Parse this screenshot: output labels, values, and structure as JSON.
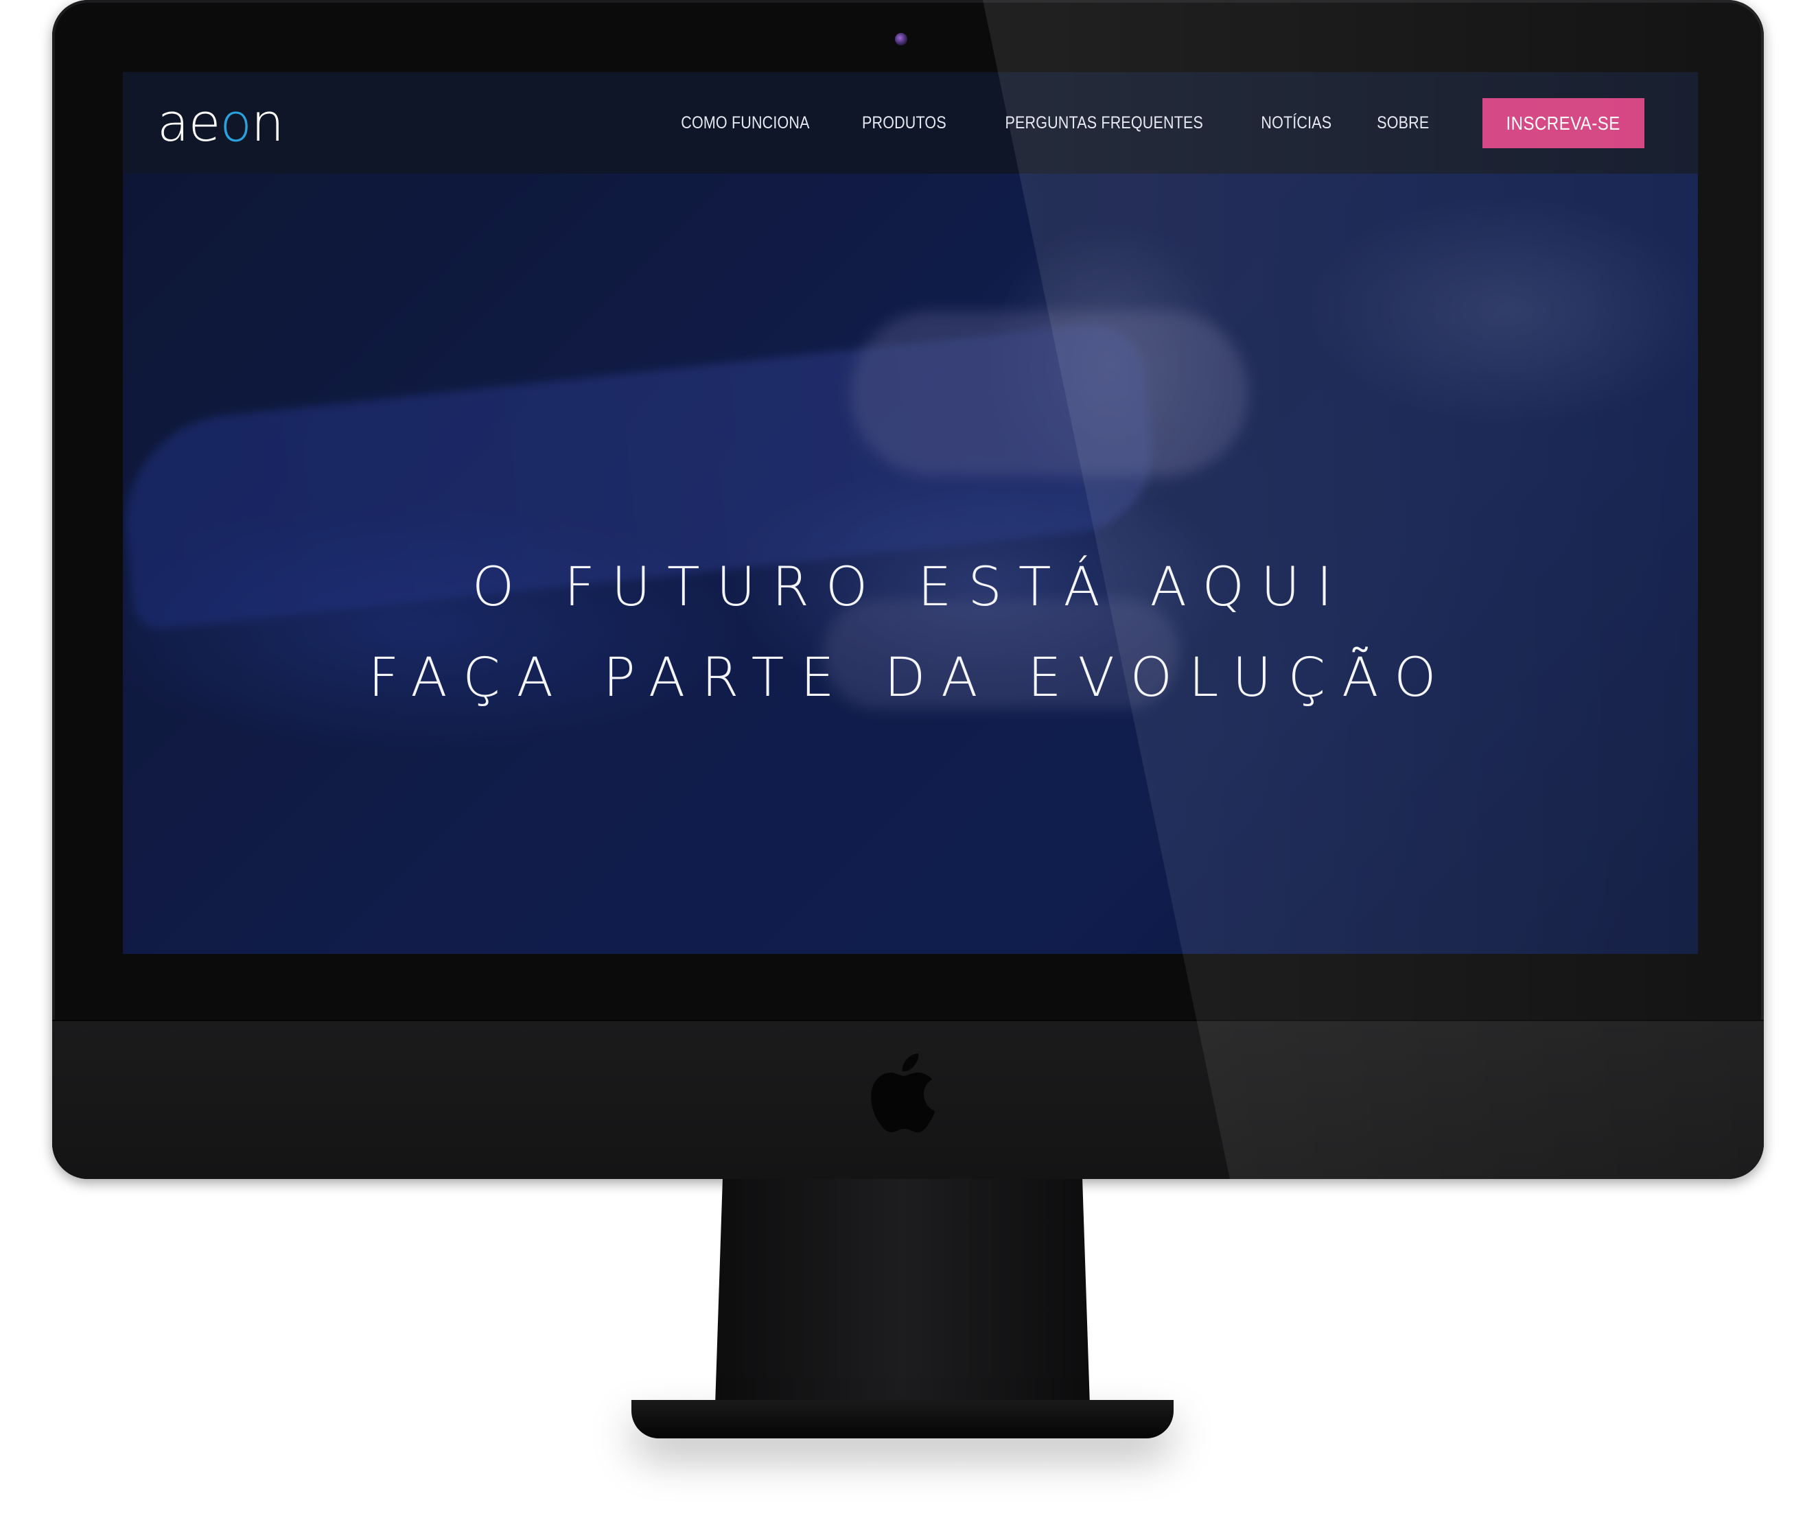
{
  "brand": {
    "logo_prefix": "ae",
    "logo_o": "o",
    "logo_suffix": "n",
    "accent_color": "#28a3e0"
  },
  "nav": {
    "items": [
      {
        "label": "COMO FUNCIONA"
      },
      {
        "label": "PRODUTOS"
      },
      {
        "label": "PERGUNTAS FREQUENTES"
      },
      {
        "label": "NOTÍCIAS"
      },
      {
        "label": "SOBRE"
      }
    ],
    "cta_label": "INSCREVA-SE",
    "cta_color": "#d3407f"
  },
  "hero": {
    "line1": "O FUTURO ESTÁ AQUI",
    "line2": "FAÇA PARTE DA EVOLUÇÃO"
  },
  "icons": {
    "device": "apple-icon"
  }
}
